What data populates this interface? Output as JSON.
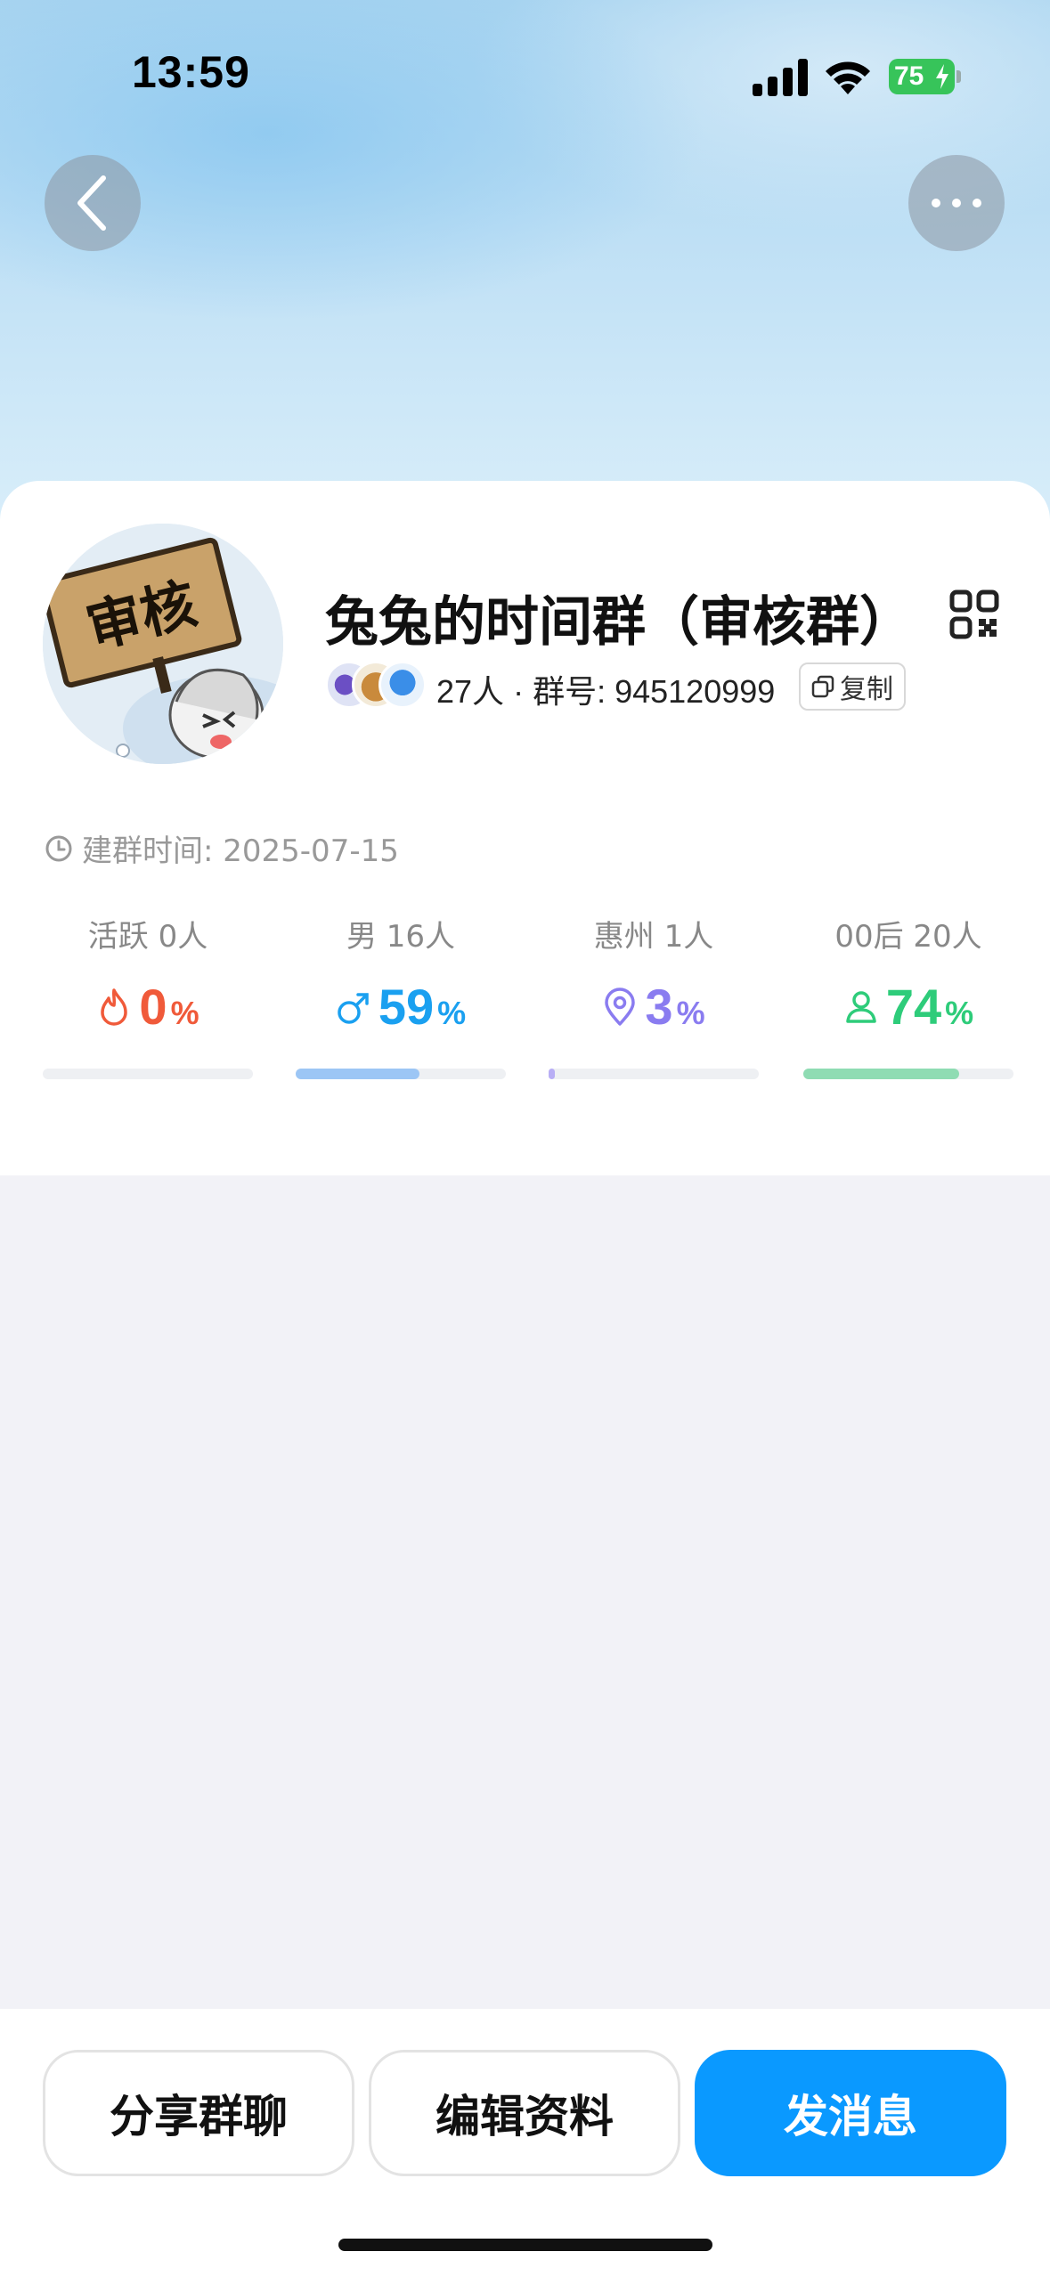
{
  "status_bar": {
    "time": "13:59",
    "battery_level": "75"
  },
  "group": {
    "name": "兔兔的时间群（审核群）",
    "avatar_sign_text": "审核",
    "member_count": "27人",
    "separator": "·",
    "group_id_label": "群号: 945120999",
    "copy_label": "复制",
    "created_label": "建群时间: 2025-07-15"
  },
  "stats": [
    {
      "label": "活跃",
      "count": "0人",
      "value": "0",
      "unit": "%",
      "percent": 0,
      "color": "#f05a3a",
      "icon": "flame-icon",
      "fill_color": "#f05a3a"
    },
    {
      "label": "男",
      "count": "16人",
      "value": "59",
      "unit": "%",
      "percent": 59,
      "color": "#1aa0f0",
      "icon": "male-icon",
      "fill_color": "#9cc6f5"
    },
    {
      "label": "惠州",
      "count": "1人",
      "value": "3",
      "unit": "%",
      "percent": 3,
      "color": "#8a7cf0",
      "icon": "location-pin-icon",
      "fill_color": "#b8aef5"
    },
    {
      "label": "00后",
      "count": "20人",
      "value": "74",
      "unit": "%",
      "percent": 74,
      "color": "#2ecc7a",
      "icon": "person-icon",
      "fill_color": "#8fdcb3"
    }
  ],
  "actions": {
    "share": "分享群聊",
    "edit": "编辑资料",
    "send": "发消息"
  },
  "colors": {
    "accent": "#0a99ff",
    "battery": "#37c45a"
  }
}
